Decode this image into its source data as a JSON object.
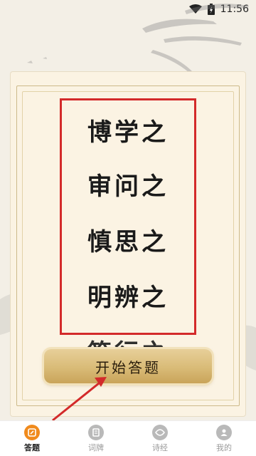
{
  "status_bar": {
    "time": "11:56"
  },
  "content": {
    "verse_lines": [
      "博学之",
      "审问之",
      "慎思之",
      "明辨之",
      "笃行之"
    ]
  },
  "start_button": {
    "label": "开始答题"
  },
  "bottom_nav": {
    "items": [
      {
        "label": "答题",
        "icon": "quiz-icon",
        "active": true
      },
      {
        "label": "词牌",
        "icon": "book-icon",
        "active": false
      },
      {
        "label": "诗经",
        "icon": "classics-icon",
        "active": false
      },
      {
        "label": "我的",
        "icon": "profile-icon",
        "active": false
      }
    ]
  },
  "colors": {
    "highlight": "#d32a2a",
    "accent": "#f08a1c",
    "button": "#d9bb77"
  }
}
